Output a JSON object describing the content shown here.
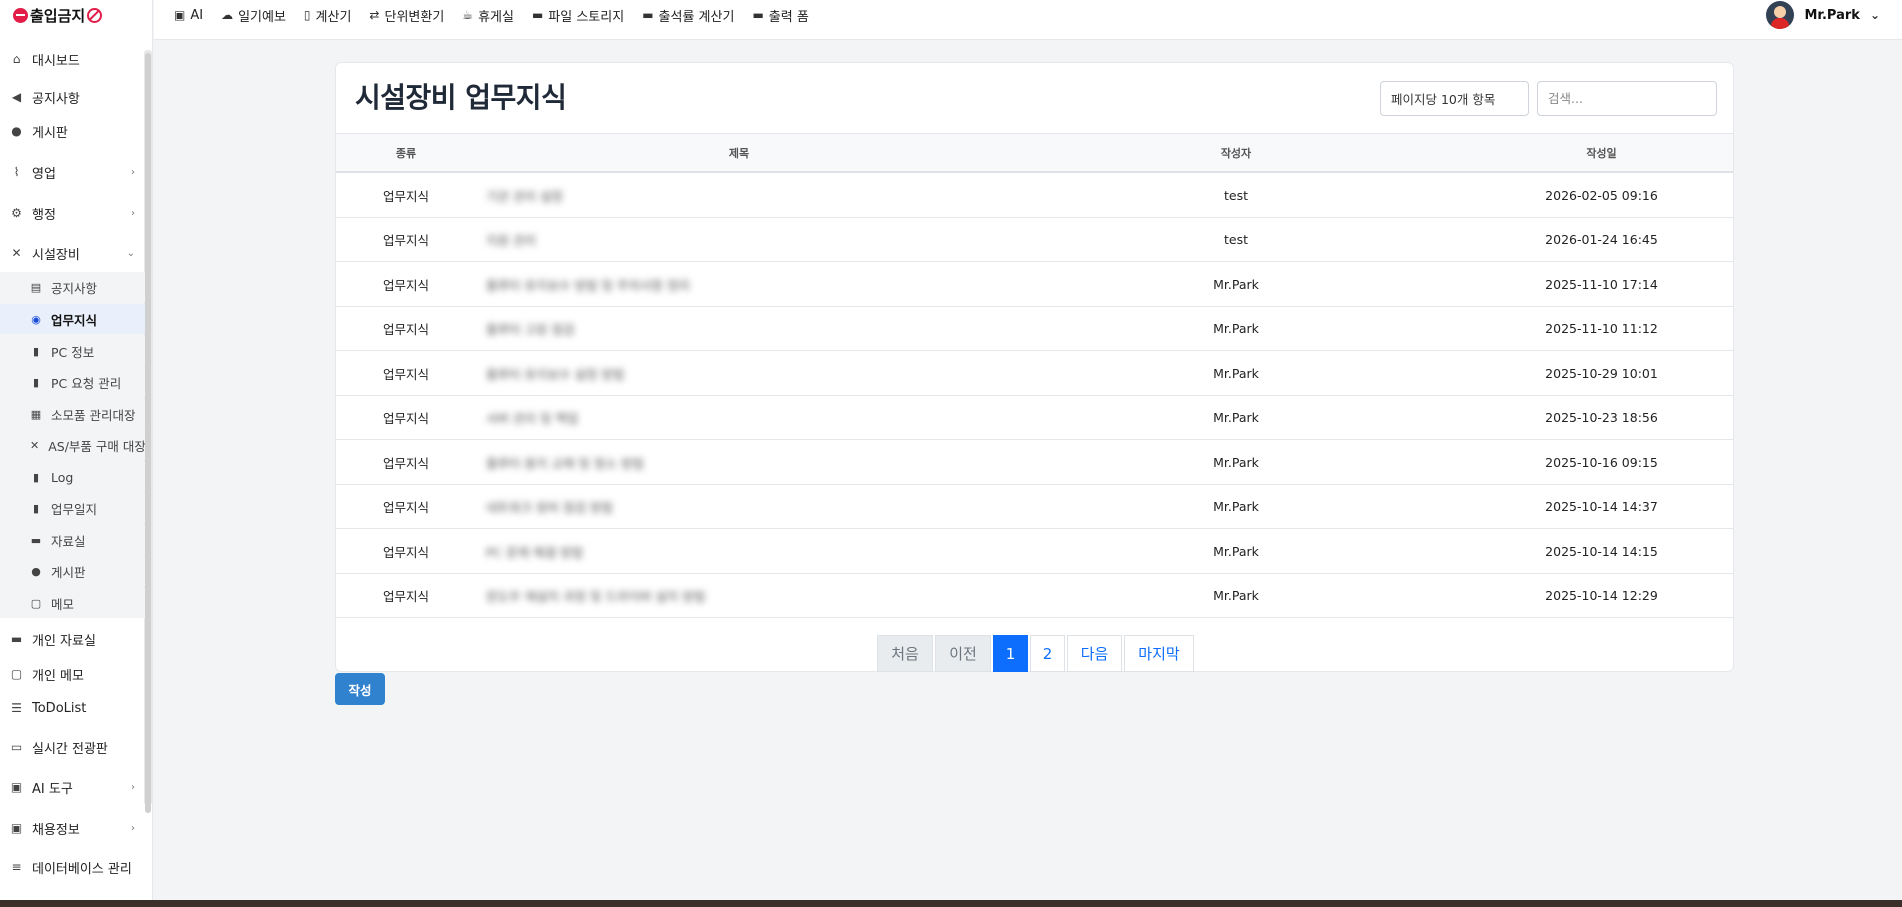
{
  "brand": {
    "name": "출입금지"
  },
  "top_nav": [
    {
      "label": "AI",
      "icon": "robot-icon"
    },
    {
      "label": "일기예보",
      "icon": "cloud-sun-icon"
    },
    {
      "label": "계산기",
      "icon": "calculator-icon"
    },
    {
      "label": "단위변환기",
      "icon": "arrows-exchange-icon"
    },
    {
      "label": "휴게실",
      "icon": "coffee-icon"
    },
    {
      "label": "파일 스토리지",
      "icon": "folder-icon"
    },
    {
      "label": "출석률 계산기",
      "icon": "folder-icon"
    },
    {
      "label": "출력 폼",
      "icon": "folder-icon"
    }
  ],
  "user": {
    "name": "Mr.Park"
  },
  "sidebar": {
    "items": [
      {
        "label": "대시보드",
        "icon": "home-icon"
      },
      {
        "label": "공지사항",
        "icon": "megaphone-icon"
      },
      {
        "label": "게시판",
        "icon": "comments-icon"
      },
      {
        "label": "영업",
        "icon": "chart-line-icon",
        "expandable": true
      },
      {
        "label": "행정",
        "icon": "gears-icon",
        "expandable": true
      },
      {
        "label": "시설장비",
        "icon": "tools-icon",
        "expandable": true,
        "expanded": true
      },
      {
        "label": "개인 자료실",
        "icon": "folder-icon"
      },
      {
        "label": "개인 메모",
        "icon": "note-icon"
      },
      {
        "label": "ToDoList",
        "icon": "list-check-icon"
      },
      {
        "label": "실시간 전광판",
        "icon": "monitor-icon"
      },
      {
        "label": "AI 도구",
        "icon": "robot-icon",
        "expandable": true
      },
      {
        "label": "채용정보",
        "icon": "robot-icon",
        "expandable": true
      },
      {
        "label": "데이터베이스 관리",
        "icon": "database-icon"
      }
    ],
    "sub_items": [
      {
        "label": "공지사항",
        "icon": "clipboard-icon"
      },
      {
        "label": "업무지식",
        "icon": "brain-icon",
        "active": true
      },
      {
        "label": "PC 정보",
        "icon": "book-icon"
      },
      {
        "label": "PC 요청 관리",
        "icon": "book-icon"
      },
      {
        "label": "소모품 관리대장",
        "icon": "boxes-icon"
      },
      {
        "label": "AS/부품 구매 대장",
        "icon": "tools-icon"
      },
      {
        "label": "Log",
        "icon": "book-icon"
      },
      {
        "label": "업무일지",
        "icon": "book-icon"
      },
      {
        "label": "자료실",
        "icon": "folder-icon"
      },
      {
        "label": "게시판",
        "icon": "comments-icon"
      },
      {
        "label": "메모",
        "icon": "note-icon"
      }
    ]
  },
  "page": {
    "title": "시설장비 업무지식",
    "per_page": "페이지당 10개 항목",
    "search_placeholder": "검색..."
  },
  "table": {
    "columns": [
      "종류",
      "제목",
      "작성자",
      "작성일"
    ],
    "rows": [
      {
        "type": "업무지식",
        "title": "기관 관리 설정",
        "author": "test",
        "date": "2026-02-05 09:16"
      },
      {
        "type": "업무지식",
        "title": "지원 관리",
        "author": "test",
        "date": "2026-01-24 16:45"
      },
      {
        "type": "업무지식",
        "title": "플루터 유지보수 방법 및 주의사항 정리",
        "author": "Mr.Park",
        "date": "2025-11-10 17:14"
      },
      {
        "type": "업무지식",
        "title": "플루터 고장 점검",
        "author": "Mr.Park",
        "date": "2025-11-10 11:12"
      },
      {
        "type": "업무지식",
        "title": "플루터 유지보수 설정 방법",
        "author": "Mr.Park",
        "date": "2025-10-29 10:01"
      },
      {
        "type": "업무지식",
        "title": "서버 관리 및 백업",
        "author": "Mr.Park",
        "date": "2025-10-23 18:56"
      },
      {
        "type": "업무지식",
        "title": "플루터 용지 교체 및 청소 방법",
        "author": "Mr.Park",
        "date": "2025-10-16 09:15"
      },
      {
        "type": "업무지식",
        "title": "네트워크 장비 점검 방법",
        "author": "Mr.Park",
        "date": "2025-10-14 14:37"
      },
      {
        "type": "업무지식",
        "title": "PC 문제 해결 방법",
        "author": "Mr.Park",
        "date": "2025-10-14 14:15"
      },
      {
        "type": "업무지식",
        "title": "윈도우 재설치 과정 및 드라이버 설치 방법",
        "author": "Mr.Park",
        "date": "2025-10-14 12:29"
      }
    ]
  },
  "pagination": {
    "first": "처음",
    "prev": "이전",
    "pages": [
      "1",
      "2"
    ],
    "current": "1",
    "next": "다음",
    "last": "마지막"
  },
  "write_button": "작성"
}
